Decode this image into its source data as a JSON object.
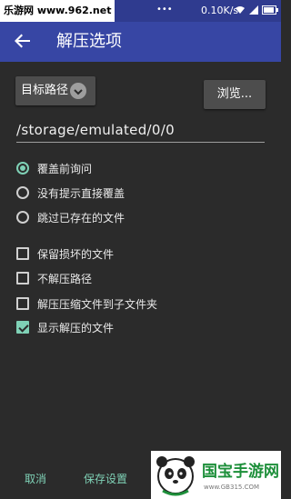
{
  "status_bar": {
    "site_label": "乐游网 www.962.net",
    "speed": "0.10K/s"
  },
  "app_bar": {
    "title": "解压选项",
    "back_icon": "arrow-back-icon"
  },
  "target": {
    "label": "目标路径",
    "dropdown_icon": "chevron-down-icon"
  },
  "browse_label": "浏览...",
  "path_value": "/storage/emulated/0/0",
  "overwrite_options": [
    {
      "label": "覆盖前询问",
      "selected": true
    },
    {
      "label": "没有提示直接覆盖",
      "selected": false
    },
    {
      "label": "跳过已存在的文件",
      "selected": false
    }
  ],
  "checkboxes": [
    {
      "label": "保留损坏的文件",
      "checked": false
    },
    {
      "label": "不解压路径",
      "checked": false
    },
    {
      "label": "解压压缩文件到子文件夹",
      "checked": false
    },
    {
      "label": "显示解压的文件",
      "checked": true
    }
  ],
  "footer": {
    "cancel": "取消",
    "save": "保存设置"
  },
  "watermark": {
    "brand": "国宝手游网",
    "url": "www.GB315.COM"
  },
  "colors": {
    "status_bar": "#2f3b8f",
    "app_bar": "#3746a4",
    "accent": "#7fd1b6",
    "background": "#2b2b2b"
  }
}
